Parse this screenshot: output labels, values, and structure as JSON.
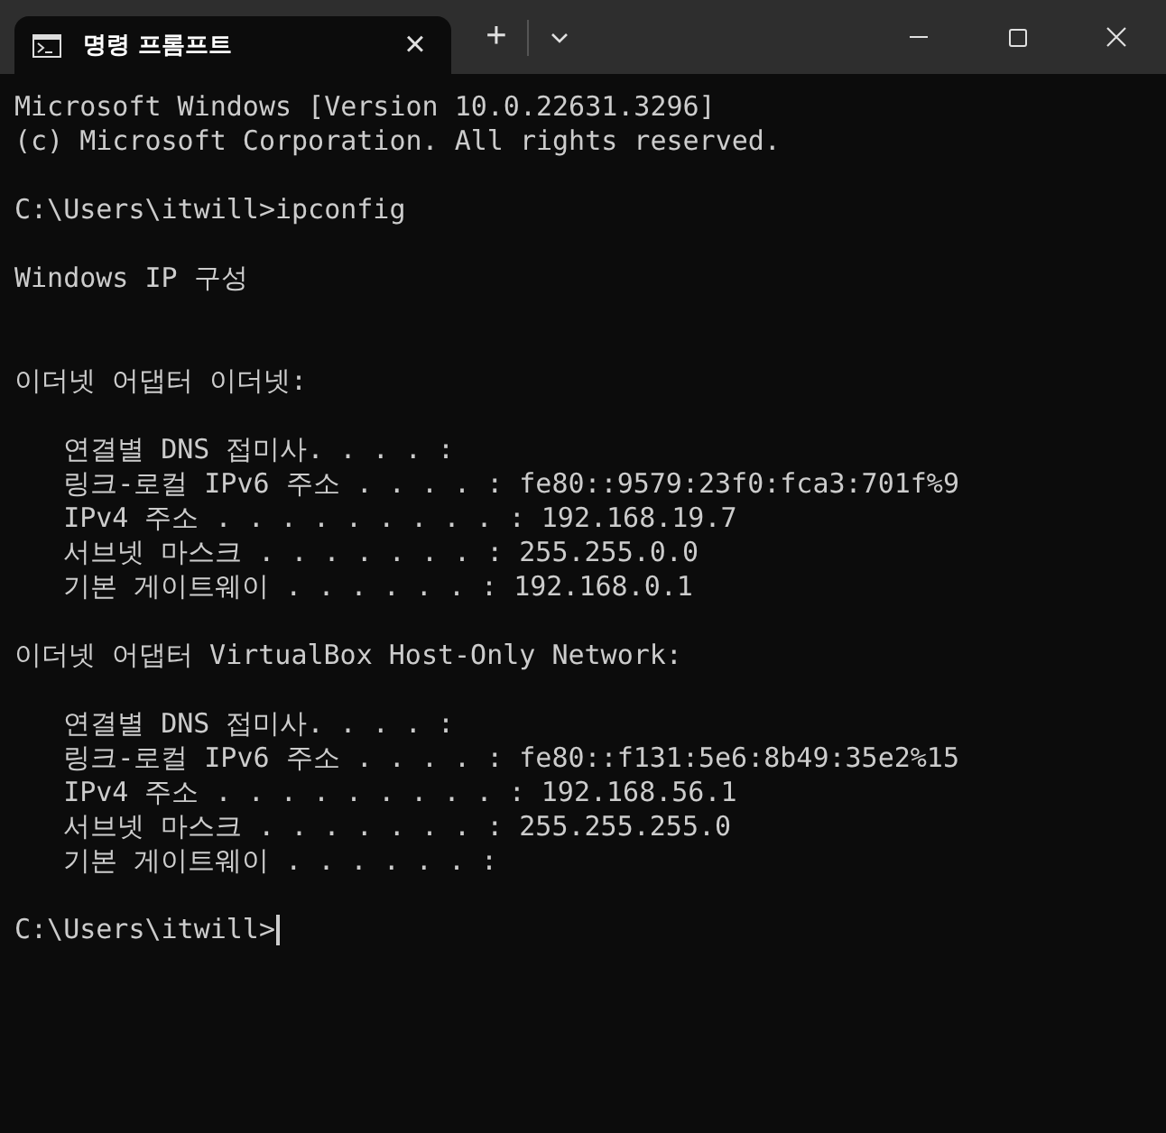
{
  "window": {
    "title": "명령 프롬프트",
    "tab_close": "×",
    "new_tab": "+"
  },
  "console": [
    {
      "kind": "line",
      "text": "Microsoft Windows [Version 10.0.22631.3296]"
    },
    {
      "kind": "line",
      "text": "(c) Microsoft Corporation. All rights reserved."
    },
    {
      "kind": "blank"
    },
    {
      "kind": "line",
      "text": "C:\\Users\\itwill>ipconfig"
    },
    {
      "kind": "blank"
    },
    {
      "kind": "line",
      "text": "Windows IP 구성"
    },
    {
      "kind": "blank"
    },
    {
      "kind": "blank"
    },
    {
      "kind": "line",
      "text": "이더넷 어댑터 이더넷:"
    },
    {
      "kind": "blank"
    },
    {
      "kind": "line",
      "text": "   연결별 DNS 접미사. . . . :"
    },
    {
      "kind": "line",
      "text": "   링크-로컬 IPv6 주소 . . . . : fe80::9579:23f0:fca3:701f%9"
    },
    {
      "kind": "line",
      "text": "   IPv4 주소 . . . . . . . . . : 192.168.19.7"
    },
    {
      "kind": "line",
      "text": "   서브넷 마스크 . . . . . . . : 255.255.0.0"
    },
    {
      "kind": "line",
      "text": "   기본 게이트웨이 . . . . . . : 192.168.0.1"
    },
    {
      "kind": "blank"
    },
    {
      "kind": "line",
      "text": "이더넷 어댑터 VirtualBox Host-Only Network:"
    },
    {
      "kind": "blank"
    },
    {
      "kind": "line",
      "text": "   연결별 DNS 접미사. . . . :"
    },
    {
      "kind": "line",
      "text": "   링크-로컬 IPv6 주소 . . . . : fe80::f131:5e6:8b49:35e2%15"
    },
    {
      "kind": "line",
      "text": "   IPv4 주소 . . . . . . . . . : 192.168.56.1"
    },
    {
      "kind": "line",
      "text": "   서브넷 마스크 . . . . . . . : 255.255.255.0"
    },
    {
      "kind": "line",
      "text": "   기본 게이트웨이 . . . . . . :"
    },
    {
      "kind": "blank"
    },
    {
      "kind": "prompt",
      "text": "C:\\Users\\itwill>"
    }
  ]
}
